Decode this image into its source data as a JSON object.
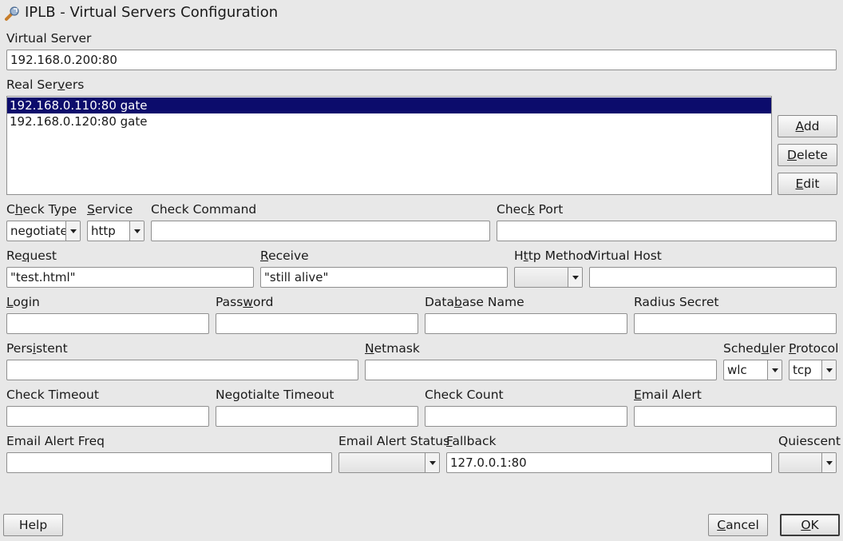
{
  "window": {
    "title": "IPLB - Virtual Servers Configuration",
    "icon": "wrench-icon"
  },
  "virtual_server": {
    "label": "Virtual Server",
    "value": "192.168.0.200:80"
  },
  "real_servers": {
    "label_pre": "Real Ser",
    "label_u": "v",
    "label_post": "ers",
    "items": [
      "192.168.0.110:80 gate",
      "192.168.0.120:80 gate"
    ],
    "selected_index": 0
  },
  "list_buttons": {
    "add": {
      "pre": "",
      "u": "A",
      "post": "dd"
    },
    "delete": {
      "pre": "",
      "u": "D",
      "post": "elete"
    },
    "edit": {
      "pre": "",
      "u": "E",
      "post": "dit"
    }
  },
  "check": {
    "type_label": {
      "pre": "C",
      "u": "h",
      "post": "eck Type"
    },
    "type_value": "negotiate",
    "service_label": {
      "pre": "",
      "u": "S",
      "post": "ervice"
    },
    "service_value": "http",
    "command_label": "Check Command",
    "command_value": "",
    "port_label": {
      "pre": "Chec",
      "u": "k",
      "post": " Port"
    },
    "port_value": ""
  },
  "request": {
    "request_label": {
      "pre": "Re",
      "u": "q",
      "post": "uest"
    },
    "request_value": "\"test.html\"",
    "receive_label": {
      "pre": "",
      "u": "R",
      "post": "eceive"
    },
    "receive_value": "\"still alive\"",
    "http_method_label": {
      "pre": "H",
      "u": "t",
      "post": "tp Method"
    },
    "http_method_value": "",
    "virtual_host_label": "Virtual Host",
    "virtual_host_value": ""
  },
  "auth": {
    "login_label": {
      "pre": "",
      "u": "L",
      "post": "ogin"
    },
    "password_label": {
      "pre": "Pass",
      "u": "w",
      "post": "ord"
    },
    "database_label": {
      "pre": "Data",
      "u": "b",
      "post": "ase Name"
    },
    "radius_label": "Radius Secret"
  },
  "persistence": {
    "persistent_label": {
      "pre": "Pers",
      "u": "i",
      "post": "stent"
    },
    "netmask_label": {
      "pre": "",
      "u": "N",
      "post": "etmask"
    },
    "scheduler_label": {
      "pre": "Sched",
      "u": "u",
      "post": "ler"
    },
    "scheduler_value": "wlc",
    "protocol_label": {
      "pre": "",
      "u": "P",
      "post": "rotocol"
    },
    "protocol_value": "tcp"
  },
  "timeouts": {
    "check_timeout_label": "Check Timeout",
    "negotiate_timeout_label": "Negotialte Timeout",
    "check_count_label": "Check Count",
    "email_alert_label": {
      "pre": "",
      "u": "E",
      "post": "mail Alert"
    }
  },
  "alerts": {
    "email_freq_label": "Email Alert Freq",
    "email_status_label": "Email Alert Status",
    "email_status_value": "",
    "fallback_label": {
      "pre": "",
      "u": "F",
      "post": "allback"
    },
    "fallback_value": "127.0.0.1:80",
    "quiescent_label": "Quiescent",
    "quiescent_value": ""
  },
  "footer": {
    "help": "Help",
    "cancel": {
      "pre": "",
      "u": "C",
      "post": "ancel"
    },
    "ok": {
      "pre": "",
      "u": "O",
      "post": "K"
    }
  }
}
